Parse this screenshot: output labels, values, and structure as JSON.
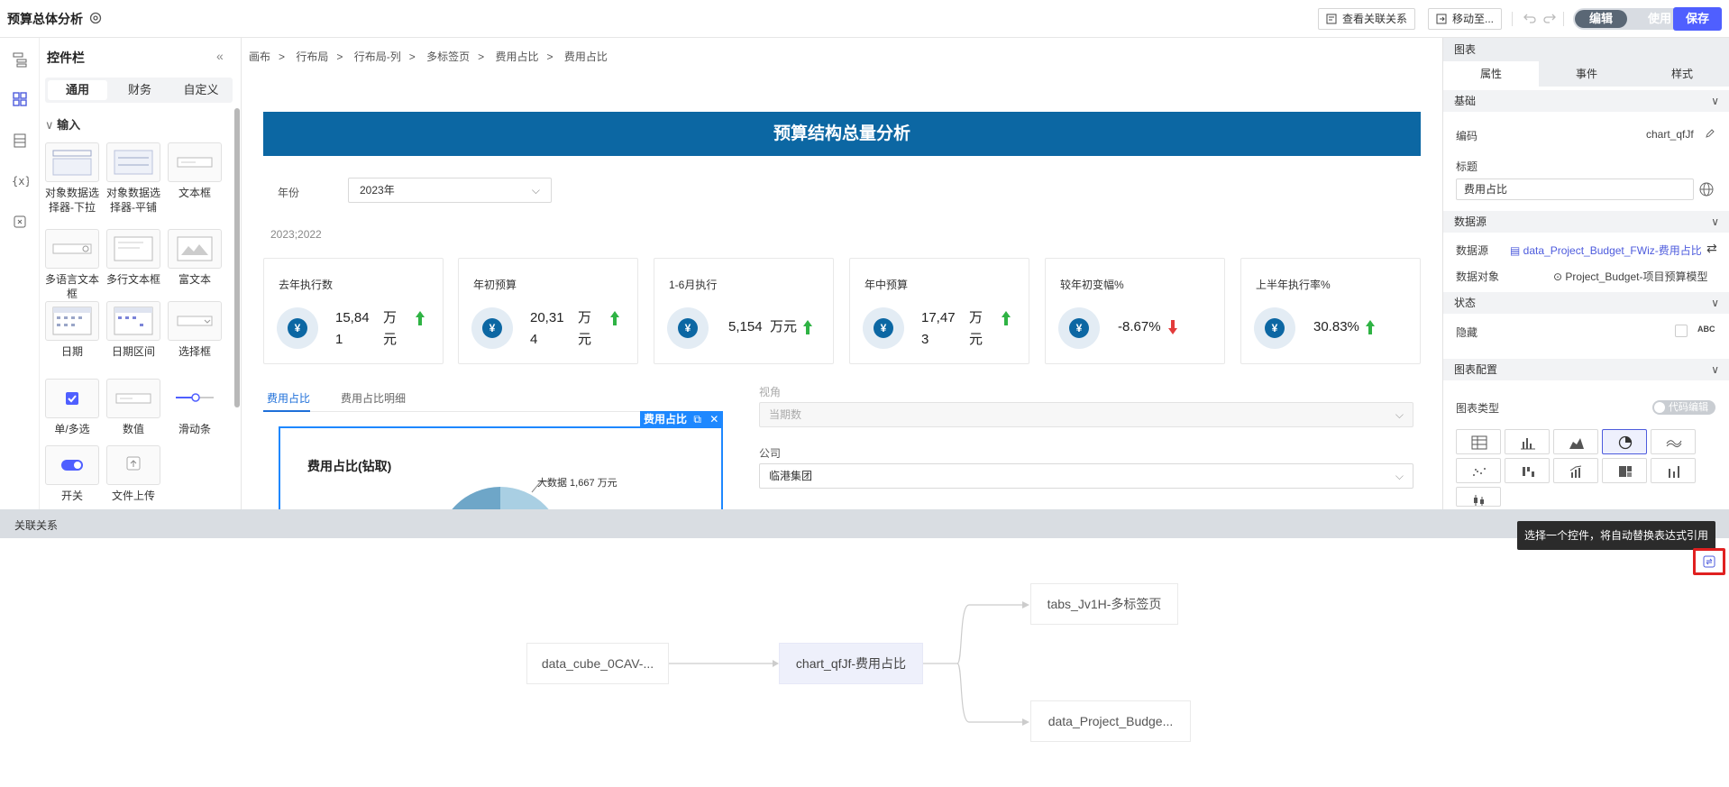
{
  "app": {
    "title": "预算总体分析"
  },
  "toolbar": {
    "view_relations": "查看关联关系",
    "move_to": "移动至...",
    "mode_edit": "编辑",
    "mode_use": "使用",
    "save": "保存"
  },
  "widget_panel": {
    "title": "控件栏",
    "tabs": [
      "通用",
      "财务",
      "自定义"
    ],
    "section": "输入",
    "items": [
      {
        "label": "对象数据选择器-下拉"
      },
      {
        "label": "对象数据选择器-平铺"
      },
      {
        "label": "文本框"
      },
      {
        "label": "多语言文本框"
      },
      {
        "label": "多行文本框"
      },
      {
        "label": "富文本"
      },
      {
        "label": "日期"
      },
      {
        "label": "日期区间"
      },
      {
        "label": "选择框"
      },
      {
        "label": "单/多选"
      },
      {
        "label": "数值"
      },
      {
        "label": "滑动条"
      },
      {
        "label": "开关"
      },
      {
        "label": "文件上传"
      }
    ]
  },
  "breadcrumb": [
    "画布",
    "行布局",
    "行布局-列",
    "多标签页",
    "费用占比",
    "费用占比"
  ],
  "canvas": {
    "banner_title": "预算结构总量分析",
    "year_label": "年份",
    "year_value": "2023年",
    "years_text": "2023;2022",
    "kpis": [
      {
        "title": "去年执行数",
        "value_l1": "15,84",
        "value_l2": "1",
        "unit_l1": "万",
        "unit_l2": "元",
        "trend": "up"
      },
      {
        "title": "年初预算",
        "value_l1": "20,31",
        "value_l2": "4",
        "unit_l1": "万",
        "unit_l2": "元",
        "trend": "up"
      },
      {
        "title": "1-6月执行",
        "value": "5,154",
        "unit": "万元",
        "trend": "up"
      },
      {
        "title": "年中预算",
        "value_l1": "17,47",
        "value_l2": "3",
        "unit_l1": "万",
        "unit_l2": "元",
        "trend": "up"
      },
      {
        "title": "较年初变幅%",
        "value": "-8.67%",
        "trend": "down"
      },
      {
        "title": "上半年执行率%",
        "value": "30.83%",
        "trend": "up"
      }
    ],
    "tabs": [
      "费用占比",
      "费用占比明细"
    ],
    "selected_tag": "费用占比",
    "chart_title": "费用占比(钻取)",
    "pie_label": "大数据 1,667 万元",
    "view_label": "视角",
    "view_placeholder": "当期数",
    "company_label": "公司",
    "company_value": "临港集团"
  },
  "props": {
    "header": "图表",
    "tabs": [
      "属性",
      "事件",
      "样式"
    ],
    "sec_basic": "基础",
    "code_label": "编码",
    "code_value": "chart_qfJf",
    "title_label": "标题",
    "title_value": "费用占比",
    "sec_datasource": "数据源",
    "ds_label": "数据源",
    "ds_value": "data_Project_Budget_FWiz-费用占比",
    "obj_label": "数据对象",
    "obj_value": "Project_Budget-项目预算模型",
    "sec_state": "状态",
    "hidden_label": "隐藏",
    "abc": "ABC",
    "sec_config": "图表配置",
    "chart_type_label": "图表类型",
    "code_edit": "代码编辑"
  },
  "relations": {
    "title": "关联关系",
    "tooltip": "选择一个控件，将自动替换表达式引用",
    "nodes": {
      "source": "data_cube_0CAV-...",
      "center": "chart_qfJf-费用占比",
      "target_top": "tabs_Jv1H-多标签页",
      "target_bottom": "data_Project_Budge..."
    }
  }
}
